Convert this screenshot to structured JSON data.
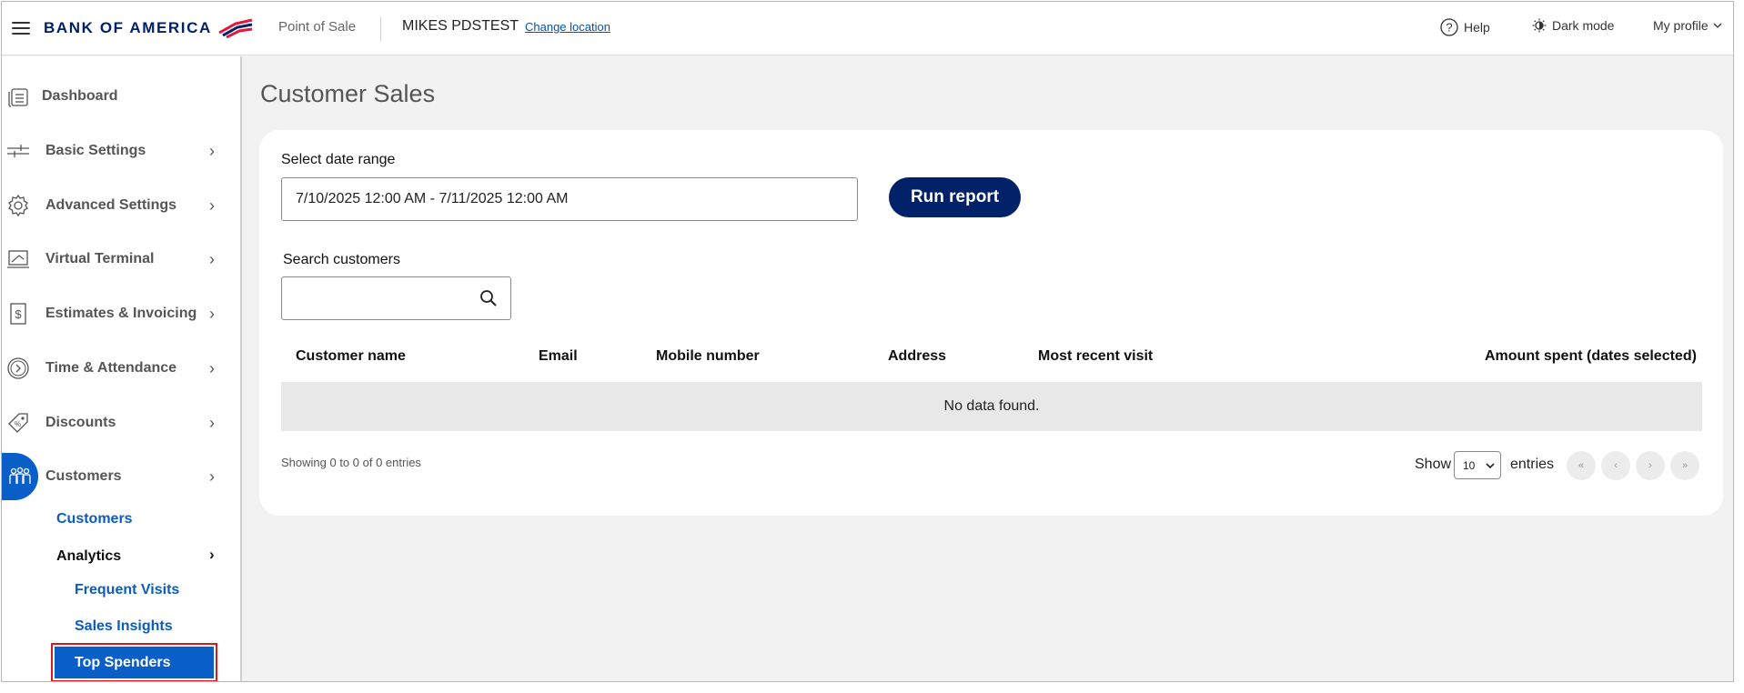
{
  "header": {
    "logo_text": "BANK OF AMERICA",
    "app_name": "Point of Sale",
    "location": "MIKES PDSTEST",
    "change_location": "Change location",
    "help": "Help",
    "dark_mode": "Dark mode",
    "profile": "My profile"
  },
  "sidebar": {
    "items": [
      {
        "label": "Dashboard",
        "icon": "dashboard-icon"
      },
      {
        "label": "Basic Settings",
        "icon": "sliders-icon"
      },
      {
        "label": "Advanced Settings",
        "icon": "gear-icon"
      },
      {
        "label": "Virtual Terminal",
        "icon": "terminal-icon"
      },
      {
        "label": "Estimates & Invoicing",
        "icon": "invoice-icon"
      },
      {
        "label": "Time & Attendance",
        "icon": "clock-icon"
      },
      {
        "label": "Discounts",
        "icon": "tag-icon"
      },
      {
        "label": "Customers",
        "icon": "people-icon"
      }
    ],
    "sub": {
      "customers": "Customers",
      "analytics": "Analytics",
      "frequent_visits": "Frequent Visits",
      "sales_insights": "Sales Insights",
      "top_spenders": "Top Spenders"
    }
  },
  "main": {
    "title": "Customer Sales",
    "date_range_label": "Select date range",
    "date_range_value": "7/10/2025 12:00 AM - 7/11/2025 12:00 AM",
    "run_report": "Run report",
    "search_label": "Search customers",
    "search_value": "",
    "columns": [
      "Customer name",
      "Email",
      "Mobile number",
      "Address",
      "Most recent visit",
      "Amount spent (dates selected)"
    ],
    "no_data": "No data found.",
    "showing": "Showing 0 to 0 of 0 entries",
    "show": "Show",
    "page_size": "10",
    "entries": "entries",
    "pager": [
      "«",
      "‹",
      "›",
      "»"
    ]
  },
  "colors": {
    "brand_navy": "#012169",
    "brand_red": "#e31837",
    "active_blue": "#0a5ec8",
    "link_blue": "#0052c2",
    "highlight_red": "#d41b24"
  }
}
